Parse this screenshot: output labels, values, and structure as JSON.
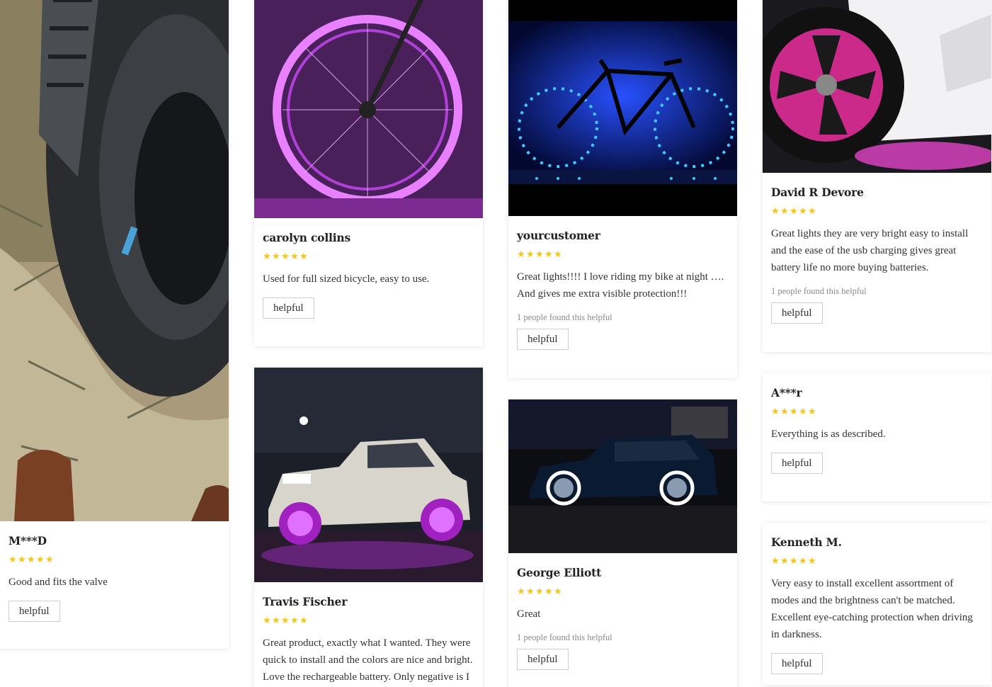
{
  "reviews": [
    {
      "name": "M***D",
      "rating": 5,
      "text": "Good and fits the valve",
      "found": "",
      "helpful_label": "helpful",
      "photo": "tire-on-grass"
    },
    {
      "name": "carolyn collins",
      "rating": 5,
      "text": "Used for full sized bicycle, easy to use.",
      "found": "",
      "helpful_label": "helpful",
      "photo": "purple-bike-wheel"
    },
    {
      "name": "Travis Fischer",
      "rating": 5,
      "text": "Great product, exactly what I wanted. They were quick to install and the colors are nice and bright. Love the rechargeable battery. Only negative is I",
      "found": "",
      "helpful_label": "helpful",
      "photo": "white-truck-purple-wheels"
    },
    {
      "name": "yourcustomer",
      "rating": 5,
      "text": "Great lights!!!! I love riding my bike at night …. And gives me extra visible protection!!!",
      "found": "1 people found this helpful",
      "helpful_label": "helpful",
      "photo": "blue-bike-night"
    },
    {
      "name": "George Elliott",
      "rating": 5,
      "text": "Great",
      "found": "1 people found this helpful",
      "helpful_label": "helpful",
      "photo": "suv-white-wheels"
    },
    {
      "name": "David R Devore",
      "rating": 5,
      "text": "Great lights they are very bright easy to install and the ease of the usb charging gives great battery life no more buying batteries.",
      "found": "1 people found this helpful",
      "helpful_label": "helpful",
      "photo": "car-pink-wheel"
    },
    {
      "name": "A***r",
      "rating": 5,
      "text": "Everything is as described.",
      "found": "",
      "helpful_label": "helpful",
      "photo": ""
    },
    {
      "name": "Kenneth M.",
      "rating": 5,
      "text": "Very easy to install excellent assortment of modes and the brightness can't be matched. Excellent eye-catching protection when driving in darkness.",
      "found": "",
      "helpful_label": "helpful",
      "photo": ""
    }
  ],
  "star_glyph": "★",
  "colors": {
    "star": "#f5c518",
    "text": "#333333",
    "muted": "#8a8a8a",
    "border": "#cfcfcf"
  }
}
